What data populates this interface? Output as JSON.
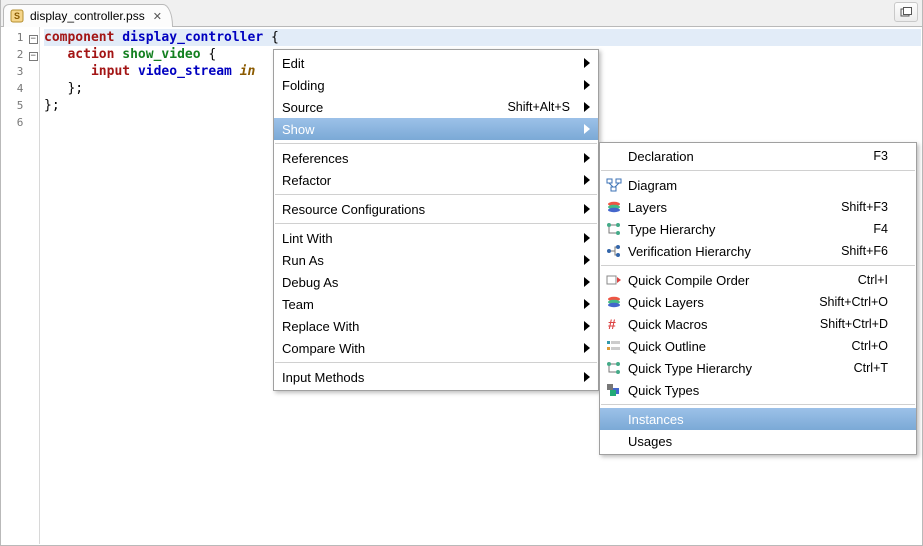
{
  "tab": {
    "filename": "display_controller.pss"
  },
  "code": {
    "lines": [
      {
        "n": 1,
        "fold": true,
        "tokens": [
          [
            "kw-red",
            "component "
          ],
          [
            "kw-blue",
            "display_controller"
          ],
          [
            "",
            " {"
          ]
        ]
      },
      {
        "n": 2,
        "fold": true,
        "tokens": [
          [
            "",
            "   "
          ],
          [
            "kw-red",
            "action "
          ],
          [
            "id-green",
            "show_video"
          ],
          [
            "",
            " {"
          ]
        ]
      },
      {
        "n": 3,
        "fold": false,
        "tokens": [
          [
            "",
            "      "
          ],
          [
            "kw-red",
            "input "
          ],
          [
            "kw-blue",
            "video_stream"
          ],
          [
            "",
            " "
          ],
          [
            "kw-brown",
            "in"
          ]
        ]
      },
      {
        "n": 4,
        "fold": false,
        "tokens": [
          [
            "",
            "   };"
          ]
        ]
      },
      {
        "n": 5,
        "fold": false,
        "tokens": [
          [
            "",
            "};"
          ]
        ]
      },
      {
        "n": 6,
        "fold": false,
        "tokens": []
      }
    ],
    "highlight_line": 1
  },
  "context_menu": {
    "groups": [
      [
        {
          "label": "Edit",
          "shortcut": "",
          "submenu": true
        },
        {
          "label": "Folding",
          "shortcut": "",
          "submenu": true
        },
        {
          "label": "Source",
          "shortcut": "Shift+Alt+S",
          "submenu": true
        },
        {
          "label": "Show",
          "shortcut": "",
          "submenu": true,
          "highlight": true
        }
      ],
      [
        {
          "label": "References",
          "shortcut": "",
          "submenu": true
        },
        {
          "label": "Refactor",
          "shortcut": "",
          "submenu": true
        }
      ],
      [
        {
          "label": "Resource Configurations",
          "shortcut": "",
          "submenu": true
        }
      ],
      [
        {
          "label": "Lint With",
          "shortcut": "",
          "submenu": true
        },
        {
          "label": "Run As",
          "shortcut": "",
          "submenu": true
        },
        {
          "label": "Debug As",
          "shortcut": "",
          "submenu": true
        },
        {
          "label": "Team",
          "shortcut": "",
          "submenu": true
        },
        {
          "label": "Replace With",
          "shortcut": "",
          "submenu": true
        },
        {
          "label": "Compare With",
          "shortcut": "",
          "submenu": true
        }
      ],
      [
        {
          "label": "Input Methods",
          "shortcut": "",
          "submenu": true
        }
      ]
    ]
  },
  "show_submenu": {
    "groups": [
      [
        {
          "icon": "",
          "label": "Declaration",
          "shortcut": "F3"
        }
      ],
      [
        {
          "icon": "diagram",
          "label": "Diagram",
          "shortcut": ""
        },
        {
          "icon": "layers",
          "label": "Layers",
          "shortcut": "Shift+F3"
        },
        {
          "icon": "type-h",
          "label": "Type Hierarchy",
          "shortcut": "F4"
        },
        {
          "icon": "verif-h",
          "label": "Verification Hierarchy",
          "shortcut": "Shift+F6"
        }
      ],
      [
        {
          "icon": "quick-comp",
          "label": "Quick Compile Order",
          "shortcut": "Ctrl+I"
        },
        {
          "icon": "layers",
          "label": "Quick Layers",
          "shortcut": "Shift+Ctrl+O"
        },
        {
          "icon": "hash",
          "label": "Quick Macros",
          "shortcut": "Shift+Ctrl+D"
        },
        {
          "icon": "outline",
          "label": "Quick Outline",
          "shortcut": "Ctrl+O"
        },
        {
          "icon": "type-h",
          "label": "Quick Type Hierarchy",
          "shortcut": "Ctrl+T"
        },
        {
          "icon": "types",
          "label": "Quick Types",
          "shortcut": ""
        }
      ],
      [
        {
          "icon": "",
          "label": "Instances",
          "shortcut": "",
          "highlight": true
        },
        {
          "icon": "",
          "label": "Usages",
          "shortcut": ""
        }
      ]
    ]
  }
}
